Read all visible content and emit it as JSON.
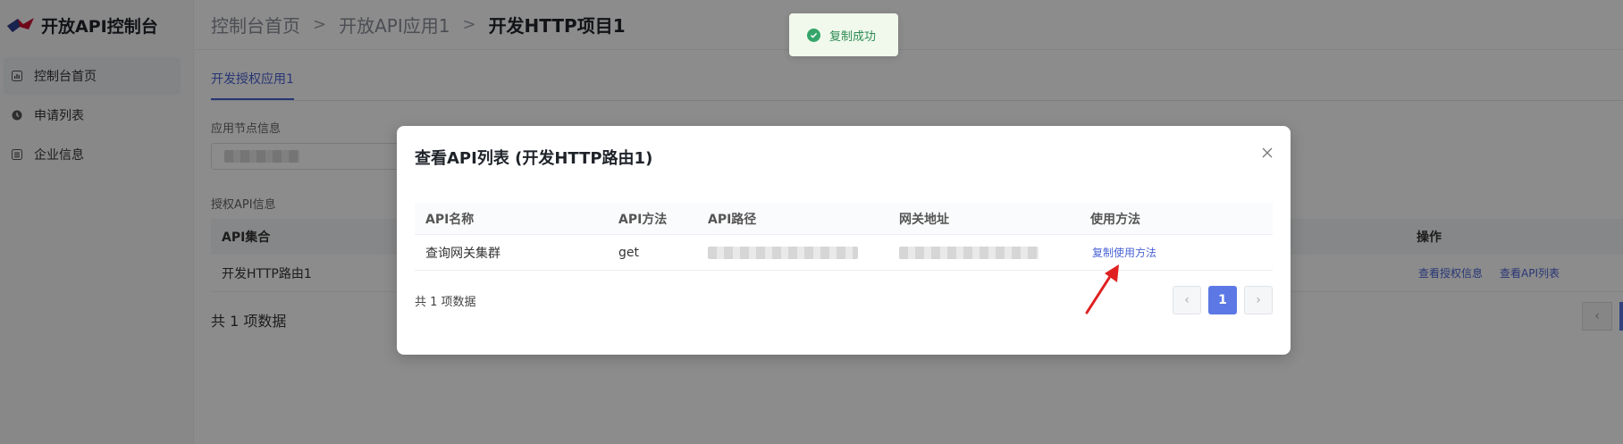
{
  "app": {
    "title": "开放API控制台"
  },
  "sidebar": {
    "items": [
      {
        "label": "控制台首页",
        "icon": "chart-icon",
        "active": true
      },
      {
        "label": "申请列表",
        "icon": "clock-icon",
        "active": false
      },
      {
        "label": "企业信息",
        "icon": "list-icon",
        "active": false
      }
    ]
  },
  "breadcrumb": {
    "items": [
      "控制台首页",
      "开放API应用1",
      "开发HTTP项目1"
    ],
    "separator": ">"
  },
  "tabs": [
    "开发授权应用1"
  ],
  "node_section": {
    "label": "应用节点信息"
  },
  "api_section": {
    "label": "授权API信息",
    "columns": [
      "API集合",
      "操作"
    ],
    "rows": [
      {
        "name": "开发HTTP路由1",
        "actions": [
          "查看授权信息",
          "查看API列表"
        ]
      }
    ],
    "total": "共 1 项数据"
  },
  "toast": {
    "text": "复制成功",
    "type": "success"
  },
  "modal": {
    "title": "查看API列表 (开发HTTP路由1)",
    "columns": [
      "API名称",
      "API方法",
      "API路径",
      "网关地址",
      "使用方法"
    ],
    "rows": [
      {
        "name": "查询网关集群",
        "method": "get",
        "path": "",
        "gateway": "",
        "action": "复制使用方法"
      }
    ],
    "total": "共 1 项数据",
    "pagination": {
      "prev": "‹",
      "current": "1",
      "next": "›"
    }
  },
  "colors": {
    "accent": "#5b78e5",
    "link": "#4a63d6",
    "success": "#35a56a",
    "annotation_arrow": "#e02020"
  }
}
